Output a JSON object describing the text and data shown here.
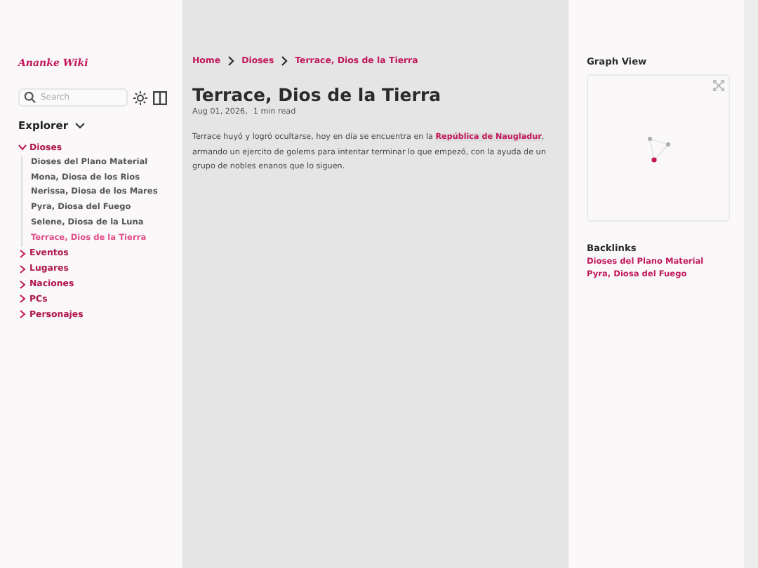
{
  "site_title": "Ananke Wiki",
  "search": {
    "placeholder": "Search"
  },
  "explorer": {
    "title": "Explorer",
    "items": [
      {
        "label": "Dioses",
        "expanded": true,
        "selected": false,
        "children": [
          {
            "label": "Dioses del Plano Material",
            "selected": false
          },
          {
            "label": "Mona, Diosa de los Rios",
            "selected": false
          },
          {
            "label": "Nerissa, Diosa de los Mares",
            "selected": false
          },
          {
            "label": "Pyra, Diosa del Fuego",
            "selected": false
          },
          {
            "label": "Selene, Diosa de la Luna",
            "selected": false
          },
          {
            "label": "Terrace, Dios de la Tierra",
            "selected": true
          }
        ]
      },
      {
        "label": "Eventos",
        "expanded": false,
        "selected": false
      },
      {
        "label": "Lugares",
        "expanded": false,
        "selected": false
      },
      {
        "label": "Naciones",
        "expanded": false,
        "selected": false
      },
      {
        "label": "PCs",
        "expanded": false,
        "selected": false
      },
      {
        "label": "Personajes",
        "expanded": false,
        "selected": false
      }
    ]
  },
  "breadcrumbs": [
    "Home",
    "Dioses",
    "Terrace, Dios de la Tierra"
  ],
  "article": {
    "title": "Terrace, Dios de la Tierra",
    "date": "Aug 01, 2026,",
    "reading_time": "1 min read",
    "body": [
      {
        "kind": "text",
        "text": "Terrace huyó y logró ocultarse, hoy en día se encuentra en la "
      },
      {
        "kind": "link",
        "text": "República de Naugladur"
      },
      {
        "kind": "text",
        "text": ", armando un ejercito de golems para intentar terminar lo que empezó, con la ayuda de un grupo de nobles enanos que lo siguen."
      }
    ]
  },
  "graph_view": {
    "title": "Graph View"
  },
  "backlinks": {
    "title": "Backlinks",
    "items": [
      "Dioses del Plano Material",
      "Pyra, Diosa del Fuego"
    ]
  }
}
